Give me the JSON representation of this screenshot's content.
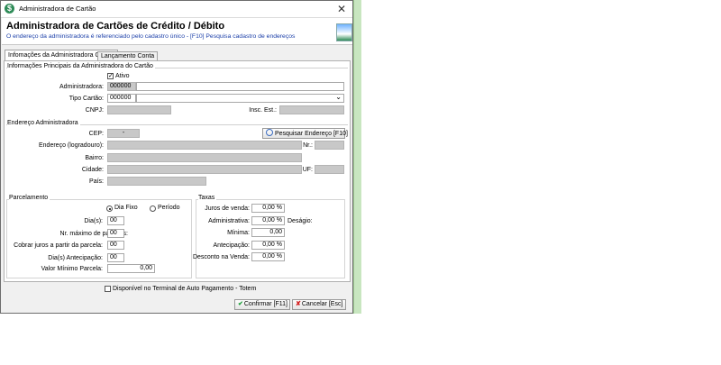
{
  "window": {
    "title": "Administradora de Cartão",
    "close_glyph": "✕"
  },
  "header": {
    "title": "Administradora de Cartões de Crédito / Débito",
    "subtitle": "O endereço da administradora é referenciado pelo cadastro único - [F10] Pesquisa cadastro de endereços"
  },
  "tabs": [
    {
      "label": "Infomações da Administradora Cartão"
    },
    {
      "label": "Lançamento Conta"
    }
  ],
  "principal": {
    "group_label": "Informações Principais da Administradora do Cartão",
    "ativo_label": "Ativo",
    "ativo_check": "✓",
    "administradora_label": "Administradora:",
    "administradora_code": "000000",
    "tipo_label": "Tipo Cartão:",
    "tipo_code": "000000",
    "tipo_arrow": "⌄",
    "cnpj_label": "CNPJ:",
    "insc_label": "Insc. Est.:"
  },
  "endereco": {
    "group_label": "Endereço Administradora",
    "cep_label": "CEP:",
    "cep_value": "-",
    "search_button": "Pesquisar Endereço [F10]",
    "logradouro_label": "Endereço (logradouro):",
    "nr_label": "Nr.:",
    "bairro_label": "Bairro:",
    "cidade_label": "Cidade:",
    "uf_label": "UF:",
    "pais_label": "País:"
  },
  "parcelamento": {
    "group_label": "Parcelamento",
    "dia_fixo_label": "Dia Fixo",
    "periodo_label": "Período",
    "dias_label": "Dia(s):",
    "dias_value": "00",
    "max_parcelas_label": "Nr. máximo de parcelas:",
    "max_parcelas_value": "00",
    "cobrar_juros_label": "Cobrar juros a partir da parcela:",
    "cobrar_juros_value": "00",
    "antecipacao_label": "Dia(s) Antecipação:",
    "antecipacao_value": "00",
    "valor_minimo_label": "Valor Mínimo Parcela:",
    "valor_minimo_value": "0,00"
  },
  "taxas": {
    "group_label": "Taxas",
    "juros_label": "Juros de venda:",
    "juros_value": "0,00 %",
    "administrativa_label": "Administrativa:",
    "administrativa_value": "0,00 %",
    "desagio_label": "Deságio:",
    "minima_label": "Mínima:",
    "minima_value": "0,00",
    "antecipacao_label": "Antecipação:",
    "antecipacao_value": "0,00 %",
    "desconto_label": "Desconto na Venda:",
    "desconto_value": "0,00 %"
  },
  "totem_label": "Disponível no Terminal de Auto Pagamento - Totem",
  "footer": {
    "confirm_label": "Confirmar [F11]",
    "cancel_label": "Cancelar [Esc]"
  },
  "colors": {
    "accent_blue": "#1a3ea8",
    "confirm_green": "#1e9e3a",
    "cancel_red": "#d42020"
  }
}
